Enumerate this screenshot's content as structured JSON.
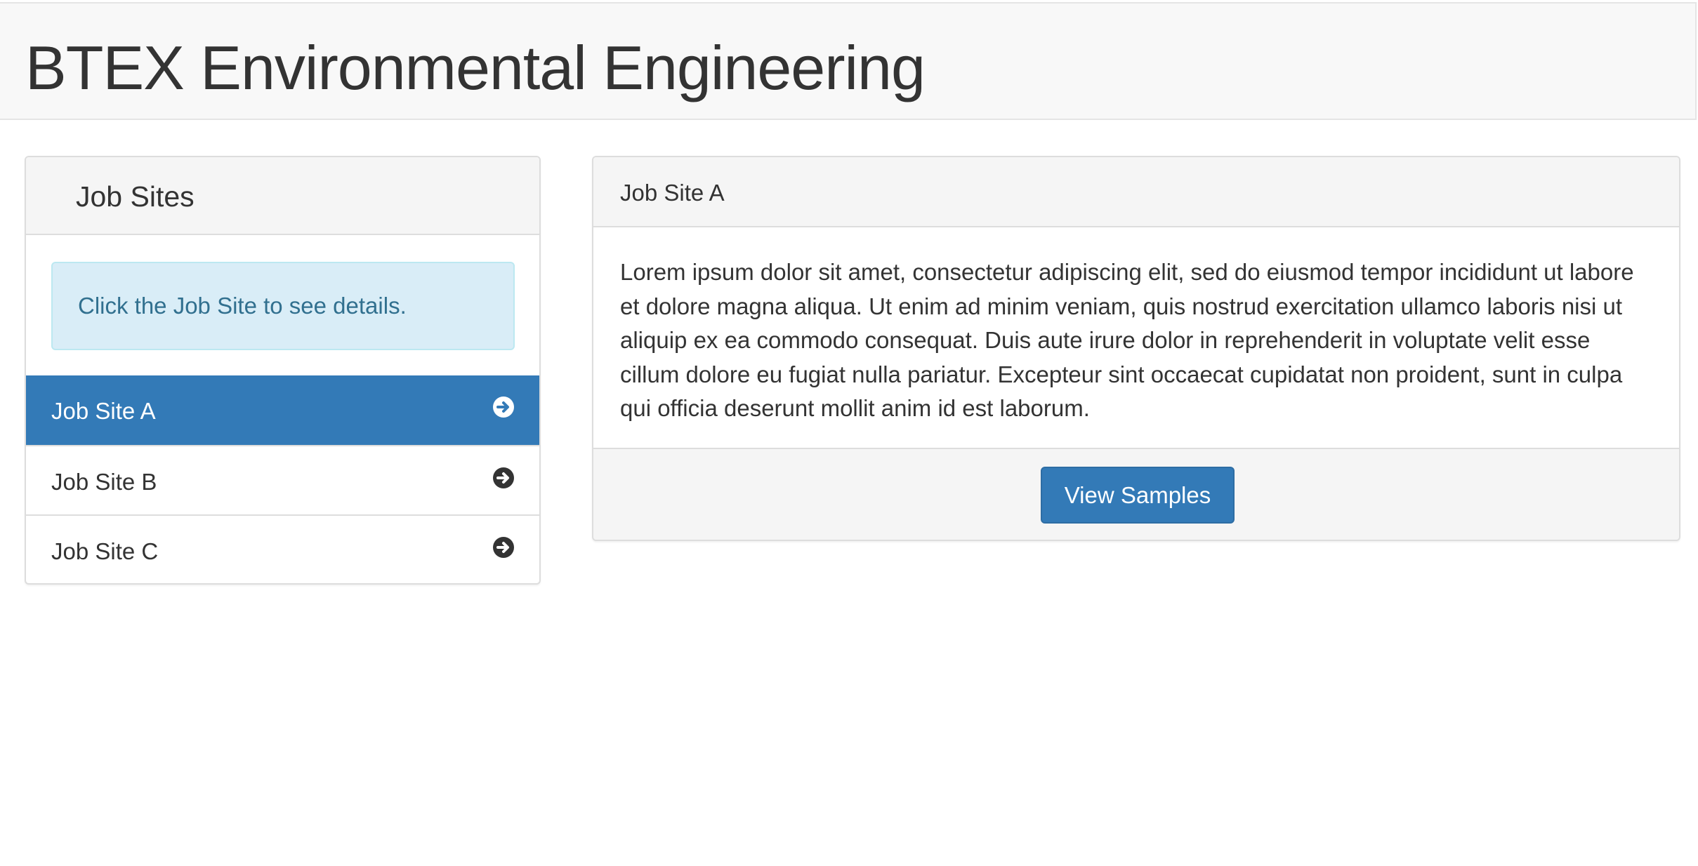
{
  "header": {
    "title": "BTEX Environmental Engineering"
  },
  "sidebar": {
    "title": "Job Sites",
    "hint": "Click the Job Site to see details.",
    "items": [
      {
        "label": "Job Site A",
        "active": true,
        "icon": "circle-arrow-right-icon"
      },
      {
        "label": "Job Site B",
        "active": false,
        "icon": "circle-arrow-right-icon"
      },
      {
        "label": "Job Site C",
        "active": false,
        "icon": "circle-arrow-right-icon"
      }
    ]
  },
  "detail": {
    "title": "Job Site A",
    "body": "Lorem ipsum dolor sit amet, consectetur adipiscing elit, sed do eiusmod tempor incididunt ut labore et dolore magna aliqua. Ut enim ad minim veniam, quis nostrud exercitation ullamco laboris nisi ut aliquip ex ea commodo consequat. Duis aute irure dolor in reprehenderit in voluptate velit esse cillum dolore eu fugiat nulla pariatur. Excepteur sint occaecat cupidatat non proident, sunt in culpa qui officia deserunt mollit anim id est laborum.",
    "button_label": "View Samples"
  },
  "colors": {
    "primary": "#337ab7",
    "info_bg": "#d9edf7",
    "info_text": "#31708f",
    "panel_heading_bg": "#f5f5f5",
    "header_bg": "#f8f8f8"
  }
}
